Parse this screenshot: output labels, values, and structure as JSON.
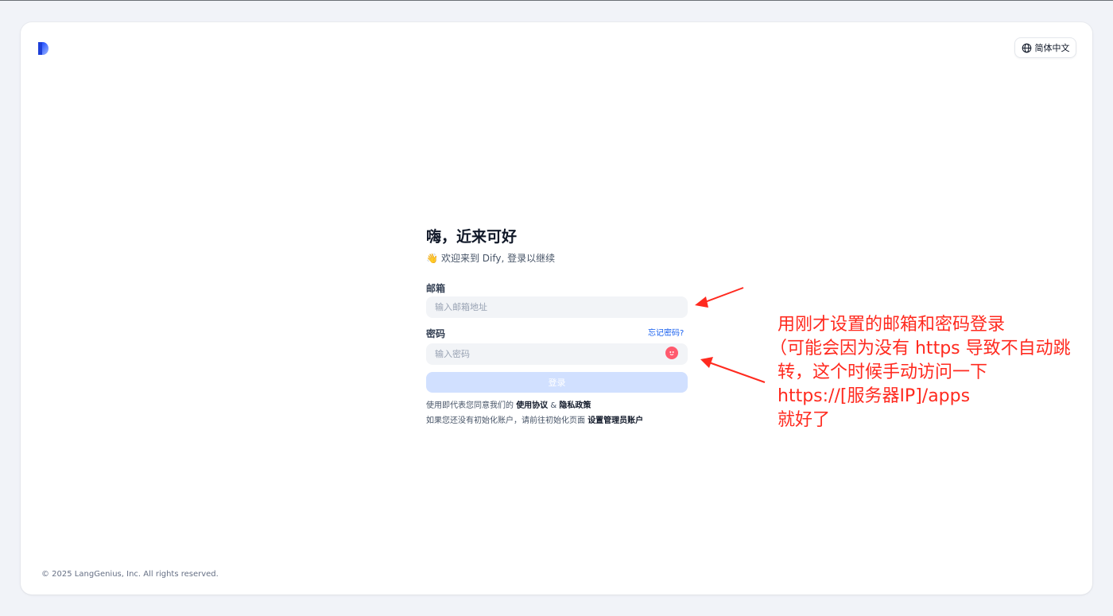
{
  "header": {
    "language_label": "简体中文",
    "language_icon": "globe-icon",
    "logo_icon": "dify-logo-icon"
  },
  "login": {
    "title": "嗨，近来可好",
    "wave_emoji": "👋",
    "subtitle": "欢迎来到 Dify, 登录以继续",
    "email_label": "邮箱",
    "email_placeholder": "输入邮箱地址",
    "email_value": "",
    "password_label": "密码",
    "forgot_password": "忘记密码?",
    "password_placeholder": "输入密码",
    "password_value": "",
    "password_toggle_icon": "eye-toggle-icon",
    "submit_label": "登录",
    "agreement_prefix": "使用即代表您同意我们的",
    "terms_link": "使用协议",
    "agreement_and": "&",
    "privacy_link": "隐私政策",
    "setup_prefix": "如果您还没有初始化账户，请前往初始化页面",
    "setup_link": "设置管理员账户"
  },
  "footer": {
    "copyright": "© 2025 LangGenius, Inc. All rights reserved."
  },
  "annotation": {
    "color": "#ff2a1f",
    "lines": [
      "用刚才设置的邮箱和密码登录",
      "（可能会因为没有 https 导致不自动跳",
      "转，这个时候手动访问一下",
      "https://[服务器IP]/apps",
      "就好了"
    ]
  },
  "colors": {
    "primary": "#155eef",
    "button_disabled": "#d1e0ff",
    "input_bg": "#f2f4f7"
  }
}
